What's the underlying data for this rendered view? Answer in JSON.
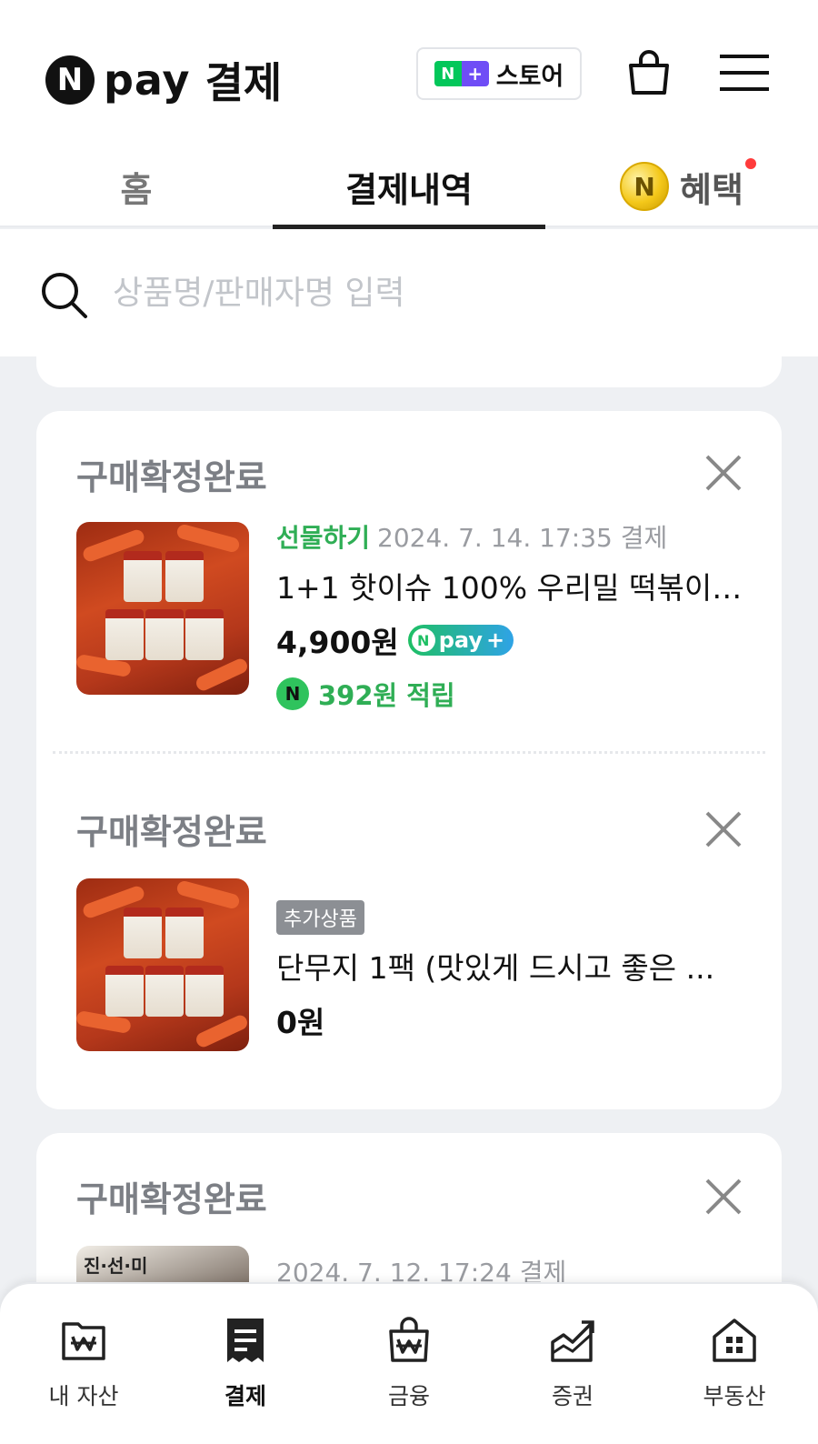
{
  "header": {
    "logo_mark": "N",
    "logo_pay": "pay",
    "logo_title": "결제",
    "store_badge_n": "N",
    "store_badge_plus": "+",
    "store_label": "스토어"
  },
  "tabs": [
    {
      "label": "홈"
    },
    {
      "label": "결제내역"
    },
    {
      "label": "혜택",
      "coin": "N"
    }
  ],
  "search": {
    "placeholder": "상품명/판매자명 입력",
    "value": ""
  },
  "orders": [
    {
      "status": "구매확정완료",
      "gift_label": "선물하기",
      "date": "2024. 7. 14. 17:35 결제",
      "title": "1+1 핫이슈 100% 우리밀 떡볶이 ...",
      "price": "4,900원",
      "pay_badge": "pay",
      "reward_icon": "N",
      "reward": "392원 적립"
    },
    {
      "status": "구매확정완료",
      "addon_badge": "추가상품",
      "title": "단무지 1팩 (맛있게 드시고 좋은 ...",
      "price": "0원"
    },
    {
      "status": "구매확정완료",
      "date": "2024. 7. 12. 17:24 결제",
      "thumb_text": "진·선·미"
    }
  ],
  "bottom_nav": [
    {
      "label": "내 자산",
      "icon": "wallet-won-icon"
    },
    {
      "label": "결제",
      "icon": "receipt-icon",
      "active": true
    },
    {
      "label": "금융",
      "icon": "bag-won-icon"
    },
    {
      "label": "증권",
      "icon": "chart-up-icon"
    },
    {
      "label": "부동산",
      "icon": "house-icon"
    }
  ],
  "colors": {
    "green": "#2fae55",
    "notification": "#ff3b3b"
  }
}
